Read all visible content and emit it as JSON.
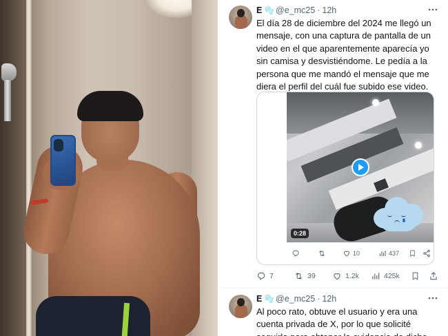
{
  "photo": {
    "description_alt": ""
  },
  "tweets": [
    {
      "name": "E",
      "badge_emoji": "🫧",
      "handle": "@e_mc25",
      "separator": "·",
      "time": "12h",
      "text": "El día 28 de diciembre del 2024 me llegó un mensaje, con una captura de pantalla de un video en el que aparentemente aparecía yo sin camisa y desvistiéndome. Le pedía a la persona que me mandó el mensaje que me diera el perfil del cuál fue subido ese video.",
      "media": {
        "duration": "0:28",
        "inner_replies": "",
        "inner_reposts": "",
        "inner_likes": "10",
        "inner_views": "437"
      },
      "actions": {
        "replies": "7",
        "reposts": "39",
        "likes": "1.2k",
        "views": "425k"
      }
    },
    {
      "name": "E",
      "badge_emoji": "🫧",
      "handle": "@e_mc25",
      "separator": "·",
      "time": "12h",
      "text": "Al poco rato, obtuve el usuario y era una cuenta privada de X, por lo que solicité seguirla para obtener la evidencia de dicho"
    }
  ],
  "icons": {
    "more": "more-icon",
    "reply": "reply-icon",
    "repost": "repost-icon",
    "like": "heart-icon",
    "views": "views-icon",
    "bookmark": "bookmark-icon",
    "share": "share-icon",
    "play": "play-icon"
  },
  "colors": {
    "accent": "#1d9bf0",
    "text": "#0f1419",
    "muted": "#536471",
    "border": "#cfd9de"
  }
}
